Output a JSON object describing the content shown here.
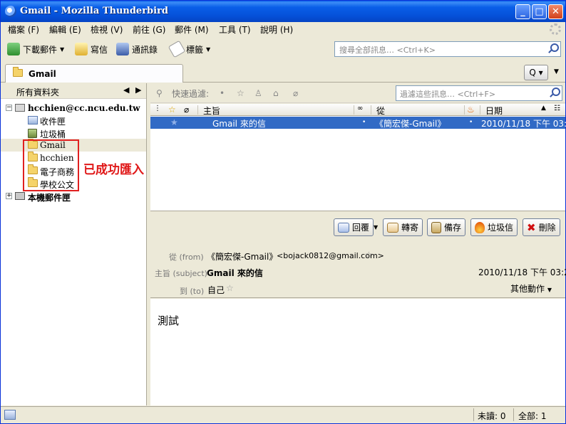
{
  "window": {
    "title": "Gmail - Mozilla Thunderbird"
  },
  "titlebar_buttons": {
    "minimize": "_",
    "maximize": "□",
    "close": "✕"
  },
  "menu": [
    "檔案 (F)",
    "編輯 (E)",
    "檢視 (V)",
    "前往 (G)",
    "郵件 (M)",
    "工具 (T)",
    "說明 (H)"
  ],
  "toolbar": {
    "get_mail": "下載郵件",
    "write": "寫信",
    "address_book": "通訊錄",
    "tag": "標籤",
    "search_placeholder": "搜尋全部訊息… <Ctrl+K>"
  },
  "tab": {
    "label": "Gmail",
    "search_button": "Q"
  },
  "folder_pane": {
    "header": "所有資料夾",
    "account": "hcchien@cc.ncu.edu.tw",
    "folders": [
      "收件匣",
      "垃圾桶",
      "Gmail",
      "hcchien",
      "電子商務",
      "學校公文"
    ],
    "local_folders": "本機郵件匣",
    "annotation": "已成功匯入"
  },
  "quick_filter": {
    "label": "快速過濾:",
    "placeholder": "過濾這些訊息… <Ctrl+F>"
  },
  "thread_columns": {
    "subject": "主旨",
    "from": "從",
    "date": "日期"
  },
  "messages": [
    {
      "subject": "Gmail 來的信",
      "from": "《簡宏傑-Gmail》",
      "date": "2010/11/18 下午 03:20"
    }
  ],
  "message_actions": {
    "reply": "回覆",
    "forward": "轉寄",
    "archive": "備存",
    "junk": "垃圾信",
    "delete": "刪除"
  },
  "message_header": {
    "from_label": "從 (from)",
    "from_name": "《簡宏傑-Gmail》",
    "from_email": "<bojack0812@gmail.com>",
    "subject_label": "主旨 (subject)",
    "subject": "Gmail 來的信",
    "date": "2010/11/18 下午 03:20",
    "to_label": "到 (to)",
    "to": "自己",
    "other_actions": "其他動作"
  },
  "message_body": "測試",
  "status": {
    "unread": "未讀: 0",
    "total": "全部: 1"
  }
}
